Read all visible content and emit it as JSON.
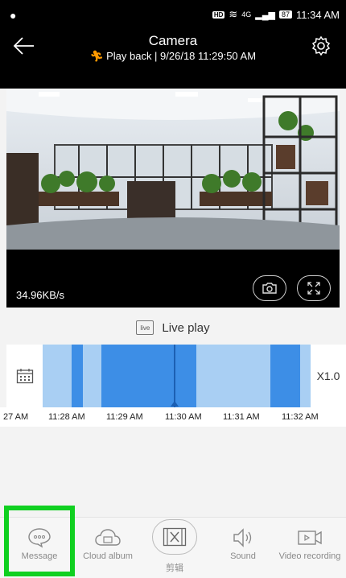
{
  "status_bar": {
    "time": "11:34 AM",
    "battery": "87",
    "network": "4G"
  },
  "header": {
    "title": "Camera",
    "subtitle": "Play back | 9/26/18 11:29:50 AM",
    "back_icon": "arrow-left-icon",
    "settings_icon": "gear-icon",
    "accent_color": "#ff9900"
  },
  "video": {
    "bitrate": "34.96KB/s",
    "screenshot_icon": "camera-icon",
    "fullscreen_icon": "expand-icon"
  },
  "live_play": {
    "label": "Live play",
    "icon_text": "live"
  },
  "timeline": {
    "speed": "X1.0",
    "calendar_icon": "calendar-icon",
    "ticks": [
      "27 AM",
      "11:28 AM",
      "11:29 AM",
      "11:30 AM",
      "11:31 AM",
      "11:32 AM"
    ],
    "recorded_color": "#3d8ee6",
    "track_color": "#a9cff3"
  },
  "bottom_bar": {
    "tabs": [
      {
        "label": "Message",
        "icon": "chat-icon"
      },
      {
        "label": "Cloud album",
        "icon": "cloud-icon"
      },
      {
        "label": "剪辑",
        "icon": "film-edit-icon"
      },
      {
        "label": "Sound",
        "icon": "speaker-icon"
      },
      {
        "label": "Video recording",
        "icon": "video-record-icon"
      }
    ]
  }
}
